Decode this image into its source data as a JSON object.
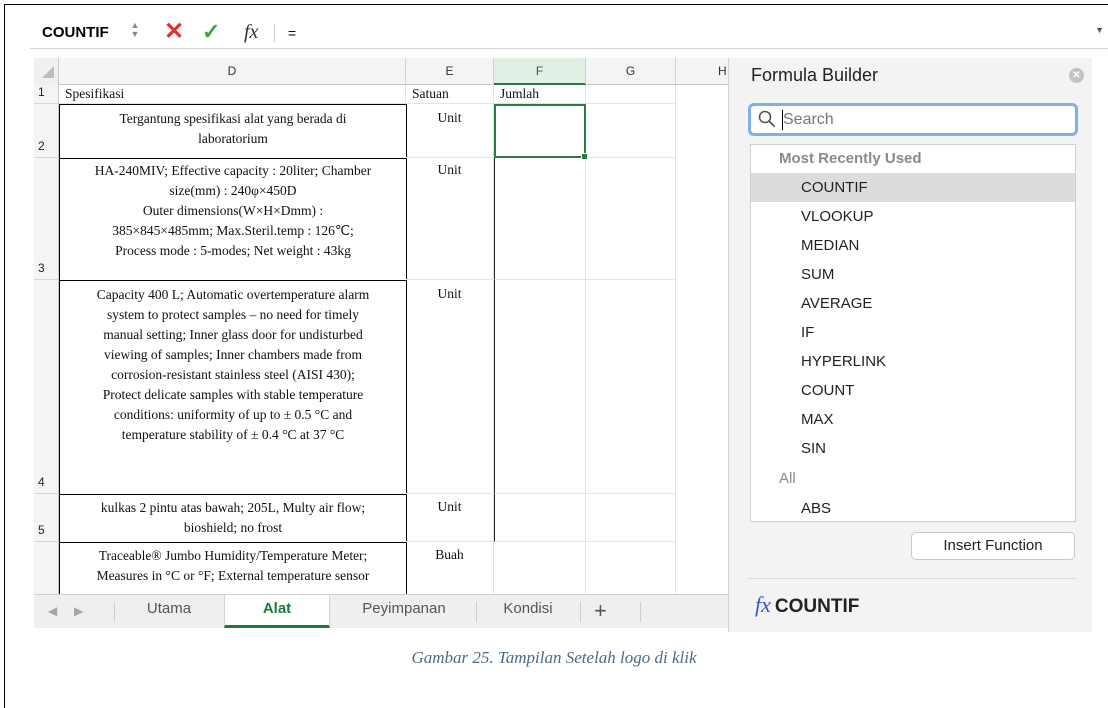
{
  "formula_bar": {
    "name_box": "COUNTIF",
    "content": "="
  },
  "columns": [
    {
      "letter": "D",
      "active": false
    },
    {
      "letter": "E",
      "active": false
    },
    {
      "letter": "F",
      "active": true
    },
    {
      "letter": "G",
      "active": false
    },
    {
      "letter": "H",
      "active": false
    }
  ],
  "rows": [
    {
      "num": "1",
      "spec": [
        "Spesifikasi"
      ],
      "satuan": "Satuan",
      "jumlah": "Jumlah"
    },
    {
      "num": "2",
      "spec": [
        "Tergantung spesifikasi alat yang berada di",
        "laboratorium"
      ],
      "satuan": "Unit",
      "jumlah": ""
    },
    {
      "num": "3",
      "spec": [
        "HA-240MIV; Effective capacity : 20liter; Chamber",
        "size(mm) : 240φ×450D",
        "Outer dimensions(W×H×Dmm) :",
        "385×845×485mm; Max.Steril.temp : 126℃;",
        "Process mode : 5-modes; Net weight : 43kg"
      ],
      "satuan": "Unit",
      "jumlah": ""
    },
    {
      "num": "4",
      "spec": [
        "Capacity 400 L; Automatic overtemperature alarm",
        "system to protect samples – no need for timely",
        "manual setting; Inner glass door for undisturbed",
        "viewing of samples;  Inner chambers made from",
        "corrosion-resistant stainless steel (AISI 430);",
        "Protect delicate samples with stable temperature",
        "conditions: uniformity of up to ± 0.5 °C and",
        "temperature stability of ± 0.4 °C at 37 °C"
      ],
      "satuan": "Unit",
      "jumlah": ""
    },
    {
      "num": "5",
      "spec": [
        "kulkas 2 pintu atas bawah; 205L, Multy air flow;",
        "bioshield; no frost"
      ],
      "satuan": "Unit",
      "jumlah": ""
    },
    {
      "num": "",
      "spec": [
        "Traceable® Jumbo Humidity/Temperature Meter;",
        "Measures in °C or °F; External temperature sensor"
      ],
      "satuan": "Buah",
      "jumlah": ""
    }
  ],
  "sheet_tabs": [
    {
      "label": "Utama",
      "active": false
    },
    {
      "label": "Alat",
      "active": true
    },
    {
      "label": "Peyimpanan",
      "active": false
    },
    {
      "label": "Kondisi",
      "active": false
    }
  ],
  "formula_builder": {
    "title": "Formula Builder",
    "search_placeholder": "Search",
    "recent_header": "Most Recently Used",
    "recent": [
      "COUNTIF",
      "VLOOKUP",
      "MEDIAN",
      "SUM",
      "AVERAGE",
      "IF",
      "HYPERLINK",
      "COUNT",
      "MAX",
      "SIN"
    ],
    "selected": "COUNTIF",
    "all_header": "All",
    "all": [
      "ABS"
    ],
    "insert_label": "Insert Function",
    "footer_function": "COUNTIF"
  },
  "caption": "Gambar 25. Tampilan Setelah logo di klik",
  "colors": {
    "accent_green": "#1c7a3a",
    "cancel_red": "#e0322b",
    "accept_green": "#3aa64a",
    "fx_blue": "#2f5ad0"
  }
}
